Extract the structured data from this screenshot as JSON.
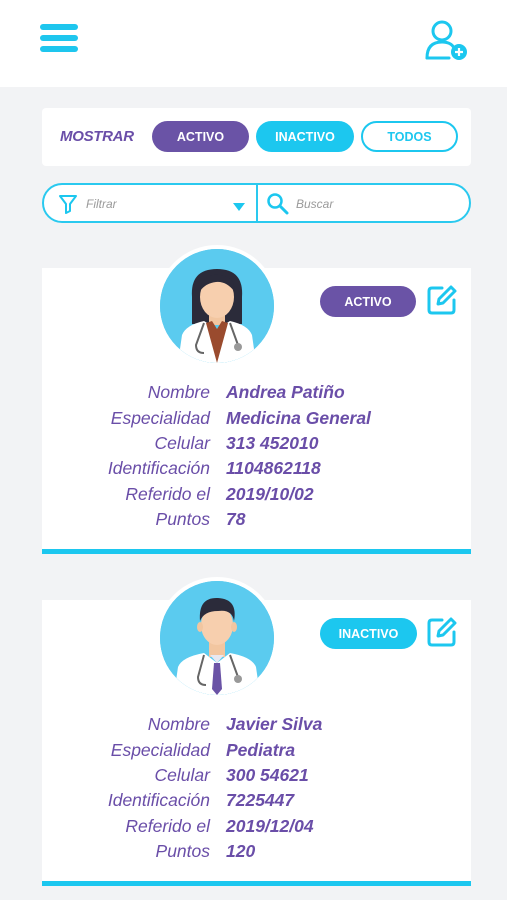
{
  "header": {
    "menu_icon": "hamburger-menu-icon",
    "add_user_icon": "add-user-icon",
    "accent_color": "#1cc7ef",
    "brand_color": "#6a53a6"
  },
  "filters": {
    "mostrar_label": "MOSTRAR",
    "options": [
      {
        "label": "ACTIVO"
      },
      {
        "label": "INACTIVO"
      },
      {
        "label": "TODOS"
      }
    ]
  },
  "search": {
    "filter_placeholder": "Filtrar",
    "search_placeholder": "Buscar"
  },
  "field_labels": {
    "nombre": "Nombre",
    "especialidad": "Especialidad",
    "celular": "Celular",
    "identificacion": "Identificación",
    "referido": "Referido el",
    "puntos": "Puntos"
  },
  "doctors": [
    {
      "status": "ACTIVO",
      "status_color": "#6a53a6",
      "nombre": "Andrea Patiño",
      "especialidad": "Medicina General",
      "celular": "313 452010",
      "identificacion": "1104862118",
      "referido": "2019/10/02",
      "puntos": "78"
    },
    {
      "status": "INACTIVO",
      "status_color": "#1cc7ef",
      "nombre": "Javier Silva",
      "especialidad": "Pediatra",
      "celular": "300 54621",
      "identificacion": "7225447",
      "referido": "2019/12/04",
      "puntos": "120"
    }
  ]
}
